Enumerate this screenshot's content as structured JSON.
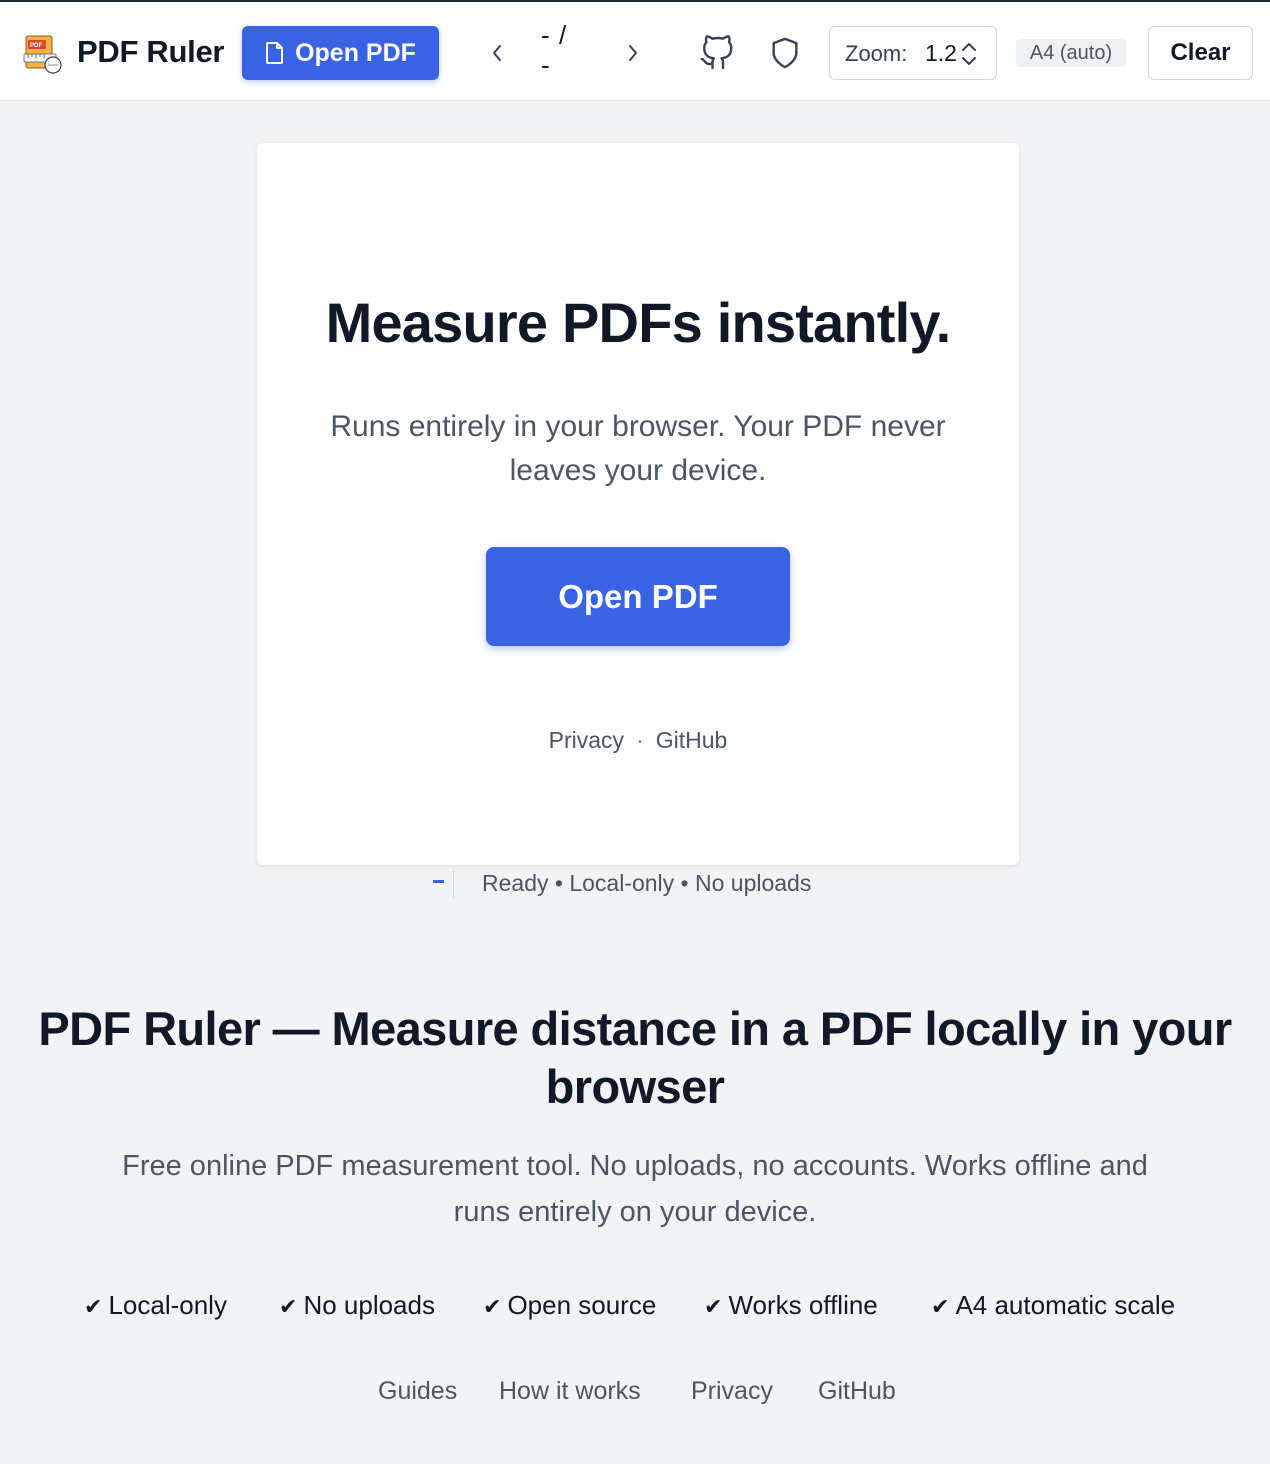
{
  "header": {
    "title": "PDF Ruler",
    "open_label": "Open PDF",
    "page_current": "-",
    "page_sep": "/",
    "page_total": "-",
    "zoom_label": "Zoom:",
    "zoom_value": "1.2",
    "paper_badge": "A4 (auto)",
    "clear_label": "Clear"
  },
  "card": {
    "title": "Measure PDFs instantly.",
    "subtitle": "Runs entirely in your browser. Your PDF never leaves your device.",
    "open_label": "Open PDF",
    "links": [
      "Privacy",
      "GitHub"
    ],
    "link_sep": "·"
  },
  "status": {
    "text": "Ready • Local-only • No uploads"
  },
  "seo": {
    "title": "PDF Ruler — Measure distance in a PDF locally in your browser",
    "subtitle": "Free online PDF measurement tool. No uploads, no accounts. Works offline and runs entirely on your device."
  },
  "features": [
    {
      "check": "✔",
      "label": "Local-only"
    },
    {
      "check": "✔",
      "label": "No uploads"
    },
    {
      "check": "✔",
      "label": "Open source"
    },
    {
      "check": "✔",
      "label": "Works offline"
    },
    {
      "check": "✔",
      "label": "A4 automatic scale"
    }
  ],
  "footer": [
    "Guides",
    "How it works",
    "Privacy",
    "GitHub"
  ],
  "colors": {
    "accent": "#3a63e4",
    "background": "#f2f3f5",
    "text": "#111827",
    "muted": "#4b5563"
  }
}
